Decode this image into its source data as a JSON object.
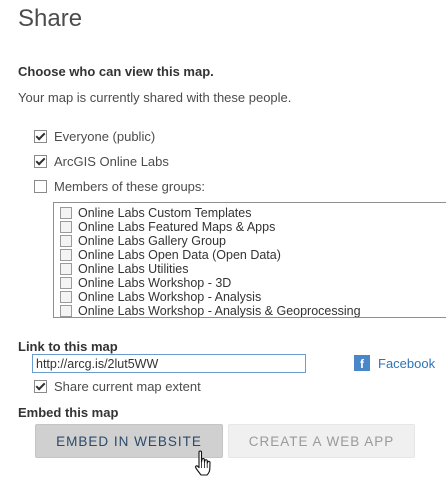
{
  "title": "Share",
  "choose_heading": "Choose who can view this map.",
  "shared_desc": "Your map is currently shared with these people.",
  "options": [
    {
      "label": "Everyone (public)",
      "checked": true
    },
    {
      "label": "ArcGIS Online Labs",
      "checked": true
    },
    {
      "label": "Members of these groups:",
      "checked": false
    }
  ],
  "groups": [
    "Online Labs Custom Templates",
    "Online Labs Featured Maps & Apps",
    "Online Labs Gallery Group",
    "Online Labs Open Data (Open Data)",
    "Online Labs Utilities",
    "Online Labs Workshop - 3D",
    "Online Labs Workshop - Analysis",
    "Online Labs Workshop - Analysis & Geoprocessing"
  ],
  "link": {
    "heading": "Link to this map",
    "value": "http://arcg.is/2lut5WW",
    "facebook": "Facebook",
    "share_extent": "Share current map extent",
    "share_extent_checked": true
  },
  "embed": {
    "heading": "Embed this map",
    "embed_button": "EMBED IN WEBSITE",
    "webapp_button": "CREATE A WEB APP"
  }
}
